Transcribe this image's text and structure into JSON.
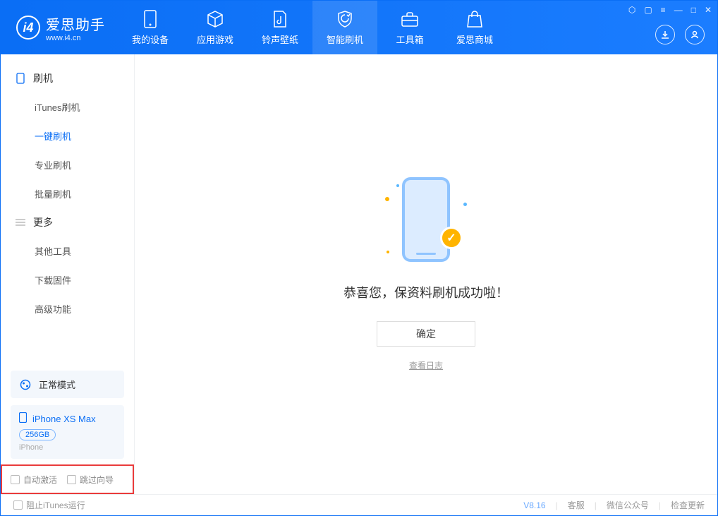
{
  "brand": {
    "title": "爱思助手",
    "sub": "www.i4.cn"
  },
  "nav": {
    "items": [
      {
        "label": "我的设备"
      },
      {
        "label": "应用游戏"
      },
      {
        "label": "铃声壁纸"
      },
      {
        "label": "智能刷机"
      },
      {
        "label": "工具箱"
      },
      {
        "label": "爱思商城"
      }
    ]
  },
  "sidebar": {
    "groups": [
      {
        "title": "刷机",
        "items": [
          "iTunes刷机",
          "一键刷机",
          "专业刷机",
          "批量刷机"
        ]
      },
      {
        "title": "更多",
        "items": [
          "其他工具",
          "下载固件",
          "高级功能"
        ]
      }
    ],
    "mode": "正常模式",
    "device": {
      "name": "iPhone XS Max",
      "capacity": "256GB",
      "type": "iPhone"
    },
    "opts": {
      "autoActivate": "自动激活",
      "skipGuide": "跳过向导"
    }
  },
  "main": {
    "message": "恭喜您，保资料刷机成功啦！",
    "okBtn": "确定",
    "logLink": "查看日志"
  },
  "footer": {
    "blockItunes": "阻止iTunes运行",
    "version": "V8.16",
    "links": [
      "客服",
      "微信公众号",
      "检查更新"
    ]
  }
}
